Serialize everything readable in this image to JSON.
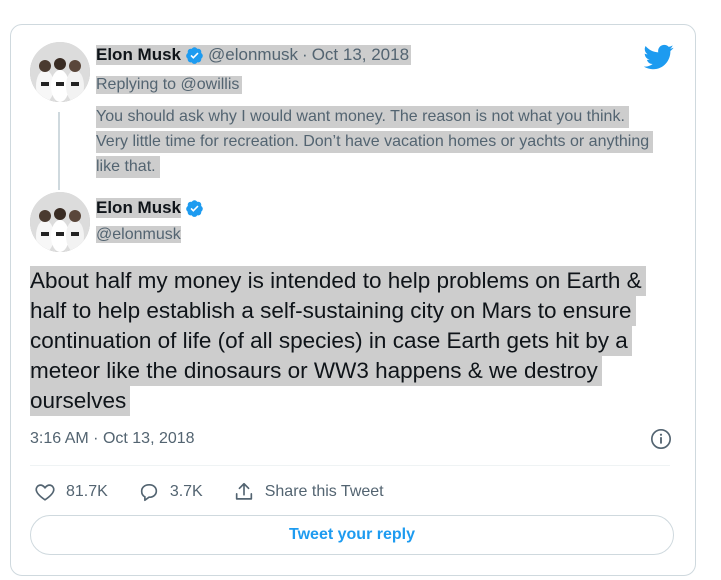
{
  "quoted": {
    "name": "Elon Musk",
    "handle": "@elonmusk",
    "separator": "·",
    "date": "Oct 13, 2018",
    "replying_prefix": "Replying to ",
    "replying_handle": "@owillis",
    "text": "You should ask why I would want money. The reason is not what you think. Very little time for recreation. Don’t have vacation homes or yachts or anything like that."
  },
  "tweet": {
    "name": "Elon Musk",
    "handle": "@elonmusk",
    "text": "About half my money is intended to help problems on Earth & half to help establish a self-sustaining city on Mars to ensure continuation of life (of all species) in case Earth gets hit by a meteor like the dinosaurs or WW3 happens & we destroy ourselves",
    "time": "3:16 AM",
    "separator": "·",
    "date": "Oct 13, 2018"
  },
  "actions": {
    "likes": "81.7K",
    "replies": "3.7K",
    "share_label": "Share this Tweet"
  },
  "reply_button": {
    "label": "Tweet your reply"
  },
  "colors": {
    "accent": "#1d9bf0",
    "muted": "#536471",
    "highlight": "#cdcdcd"
  },
  "icons": [
    "twitter-bird-icon",
    "verified-badge-icon",
    "info-icon",
    "heart-icon",
    "reply-bubble-icon",
    "share-icon"
  ]
}
